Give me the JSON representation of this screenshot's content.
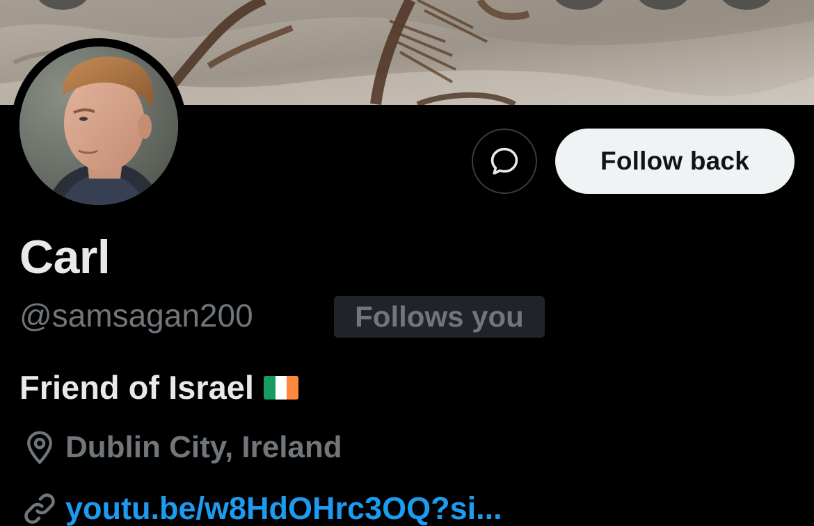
{
  "profile": {
    "name": "Carl",
    "handle": "@samsagan200",
    "follows_you_badge": "Follows you",
    "bio": "Friend of Israel",
    "bio_emoji": "irish-flag",
    "location": "Dublin City, Ireland",
    "link": "youtu.be/w8HdOHrc3OQ?si..."
  },
  "actions": {
    "message_icon": "message-bubble-icon",
    "follow_label": "Follow back"
  },
  "colors": {
    "background": "#000000",
    "primary_text": "#e7e9ea",
    "secondary_text": "#71767b",
    "link": "#1d9bf0",
    "follow_button_bg": "#eff3f4",
    "badge_bg": "#202327"
  }
}
